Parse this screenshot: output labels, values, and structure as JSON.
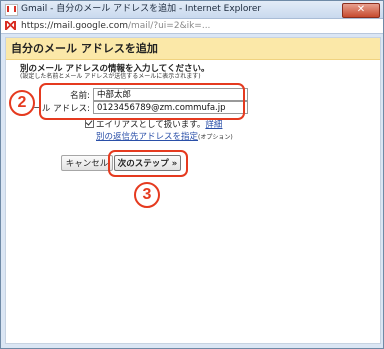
{
  "window": {
    "title": "Gmail - 自分のメール アドレスを追加 - Internet Explorer",
    "close_label": "✕",
    "address_prefix": "https://mail.google.com",
    "address_dim": "/mail/?ui=2&ik=..."
  },
  "dialog": {
    "title": "自分のメール アドレスを追加",
    "instruction": "別のメール アドレスの情報を入力してください。",
    "instruction_sub": "(設定した名前とメール アドレスが送信するメールに表示されます)",
    "name_label": "名前:",
    "name_value": "中部太郎",
    "email_label": "メール アドレス:",
    "email_value": "0123456789@zm.commufa.jp",
    "alias_label": "エイリアスとして扱います。",
    "alias_link": "詳細",
    "reply_link": "別の返信先アドレスを指定",
    "reply_note": "(オプション)",
    "cancel_label": "キャンセル",
    "next_label": "次のステップ »"
  },
  "annotations": {
    "step2": "2",
    "step3": "3",
    "color": "#e53a1f"
  }
}
